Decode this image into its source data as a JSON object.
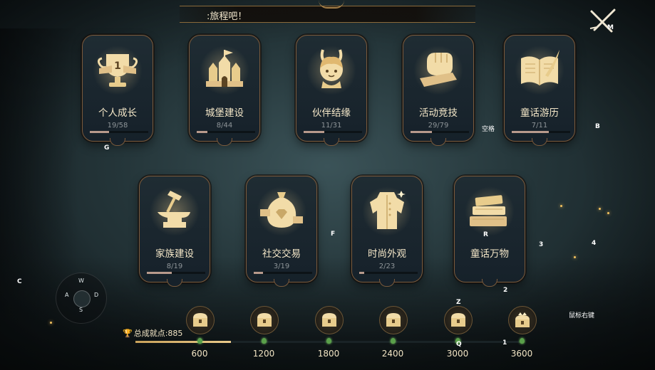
{
  "header": {
    "banner_text": ":旅程吧！"
  },
  "hotkeys": {
    "close": "M",
    "card1": "G",
    "card4": "空格",
    "card5": "B",
    "card7": "F",
    "card9": "R",
    "bottom_left": "C",
    "right_3": "3",
    "right_4": "4",
    "right_2": "2",
    "chest_z": "Z",
    "chest_q": "Q",
    "chest_1": "1",
    "right_click": "鼠标右键"
  },
  "joystick": {
    "up": "W",
    "left": "A",
    "right": "D",
    "down": "S"
  },
  "cards": [
    {
      "title": "个人成长",
      "count": "19/58",
      "progress": 0.3276,
      "icon": "trophy-icon"
    },
    {
      "title": "城堡建设",
      "count": "8/44",
      "progress": 0.1818,
      "icon": "castle-icon"
    },
    {
      "title": "伙伴结缘",
      "count": "11/31",
      "progress": 0.3548,
      "icon": "partner-icon"
    },
    {
      "title": "活动竞技",
      "count": "29/79",
      "progress": 0.3671,
      "icon": "fist-icon"
    },
    {
      "title": "童话游历",
      "count": "7/11",
      "progress": 0.6364,
      "icon": "book-icon"
    },
    {
      "title": "家族建设",
      "count": "8/19",
      "progress": 0.4211,
      "icon": "anvil-icon"
    },
    {
      "title": "社交交易",
      "count": "3/19",
      "progress": 0.1579,
      "icon": "moneybag-icon"
    },
    {
      "title": "时尚外观",
      "count": "2/23",
      "progress": 0.087,
      "icon": "outfit-icon"
    },
    {
      "title": "童话万物",
      "count": "",
      "progress": 0,
      "icon": "books-stack-icon"
    }
  ],
  "rewards": {
    "total_label": "总成就点:885",
    "total_points": 885,
    "max_points": 3600,
    "milestones": [
      "600",
      "1200",
      "1800",
      "2400",
      "3000",
      "3600"
    ]
  },
  "colors": {
    "gold": "#e9c98a",
    "card_border": "#7a5a3c",
    "progress": "#b89a8c"
  }
}
